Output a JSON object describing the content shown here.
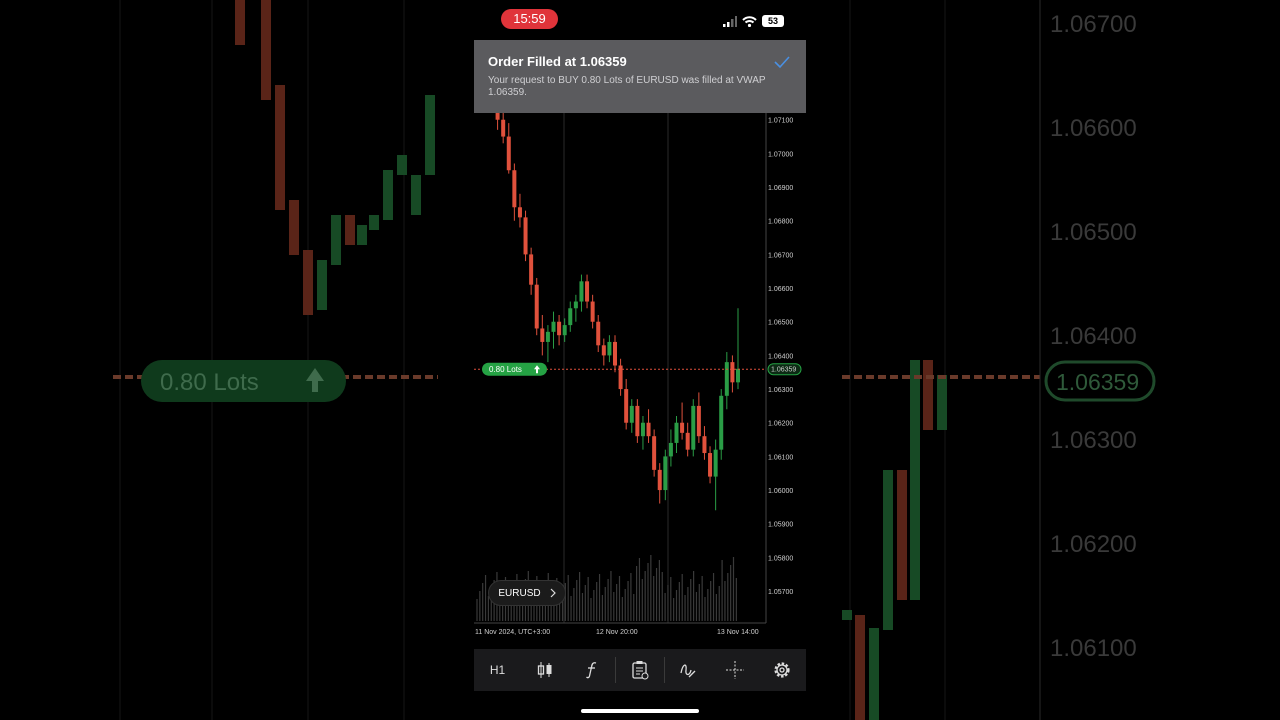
{
  "status_bar": {
    "time": "15:59",
    "battery": "53"
  },
  "toast": {
    "title": "Order Filled at 1.06359",
    "message": "Your request to BUY 0.80 Lots of EURUSD was filled at VWAP 1.06359."
  },
  "position": {
    "lots_label": "0.80 Lots",
    "price_label": "1.06359"
  },
  "symbol": "EURUSD",
  "toolbar": {
    "timeframe": "H1"
  },
  "background": {
    "lots_label": "0.80 Lots",
    "price_label": "1.06359",
    "price_ticks": [
      "1.06700",
      "1.06600",
      "1.06500",
      "1.06400",
      "1.06300",
      "1.06200",
      "1.06100"
    ]
  },
  "colors": {
    "bull": "#2a9d46",
    "bear": "#e0513c",
    "accent": "#4a90e2",
    "position": "#25a244"
  },
  "chart_data": {
    "type": "candlestick",
    "symbol": "EURUSD",
    "timeframe": "H1",
    "current_price": 1.06359,
    "position_price": 1.06359,
    "ylim": [
      1.0562,
      1.0712
    ],
    "y_ticks": [
      "1.07100",
      "1.07000",
      "1.06900",
      "1.06800",
      "1.06700",
      "1.06600",
      "1.06500",
      "1.06400",
      "1.06300",
      "1.06200",
      "1.06100",
      "1.06000",
      "1.05900",
      "1.05800",
      "1.05700"
    ],
    "x_labels": [
      "11 Nov 2024, UTC+3:00",
      "12 Nov 20:00",
      "13 Nov 14:00"
    ],
    "candles": [
      [
        1.0718,
        1.072,
        1.0712,
        1.0714
      ],
      [
        1.0714,
        1.0716,
        1.0707,
        1.071
      ],
      [
        1.071,
        1.0713,
        1.0703,
        1.0705
      ],
      [
        1.0705,
        1.0709,
        1.0694,
        1.0695
      ],
      [
        1.0695,
        1.0697,
        1.068,
        1.0684
      ],
      [
        1.0684,
        1.0688,
        1.0678,
        1.0681
      ],
      [
        1.0681,
        1.0683,
        1.0668,
        1.067
      ],
      [
        1.067,
        1.0672,
        1.0658,
        1.0661
      ],
      [
        1.0661,
        1.0663,
        1.0646,
        1.0648
      ],
      [
        1.0648,
        1.0652,
        1.064,
        1.0644
      ],
      [
        1.0644,
        1.0649,
        1.0638,
        1.0647
      ],
      [
        1.0647,
        1.0653,
        1.0642,
        1.065
      ],
      [
        1.065,
        1.0652,
        1.0643,
        1.0646
      ],
      [
        1.0646,
        1.0651,
        1.0644,
        1.0649
      ],
      [
        1.0649,
        1.0656,
        1.0647,
        1.0654
      ],
      [
        1.0654,
        1.0658,
        1.065,
        1.0656
      ],
      [
        1.0656,
        1.0664,
        1.0653,
        1.0662
      ],
      [
        1.0662,
        1.0664,
        1.0654,
        1.0656
      ],
      [
        1.0656,
        1.0658,
        1.0648,
        1.065
      ],
      [
        1.065,
        1.0652,
        1.0641,
        1.0643
      ],
      [
        1.0643,
        1.0645,
        1.0637,
        1.064
      ],
      [
        1.064,
        1.0646,
        1.0638,
        1.0644
      ],
      [
        1.0644,
        1.0646,
        1.0635,
        1.0637
      ],
      [
        1.0637,
        1.0639,
        1.0628,
        1.063
      ],
      [
        1.063,
        1.0633,
        1.0618,
        1.062
      ],
      [
        1.062,
        1.0627,
        1.0617,
        1.0625
      ],
      [
        1.0625,
        1.0627,
        1.0614,
        1.0616
      ],
      [
        1.0616,
        1.0622,
        1.0612,
        1.062
      ],
      [
        1.062,
        1.0624,
        1.0614,
        1.0616
      ],
      [
        1.0616,
        1.0618,
        1.0604,
        1.0606
      ],
      [
        1.0606,
        1.0608,
        1.0596,
        1.06
      ],
      [
        1.06,
        1.0612,
        1.0597,
        1.061
      ],
      [
        1.061,
        1.0618,
        1.0607,
        1.0614
      ],
      [
        1.0614,
        1.0622,
        1.0611,
        1.062
      ],
      [
        1.062,
        1.0626,
        1.0615,
        1.0617
      ],
      [
        1.0617,
        1.062,
        1.061,
        1.0612
      ],
      [
        1.0612,
        1.0627,
        1.061,
        1.0625
      ],
      [
        1.0625,
        1.0629,
        1.0614,
        1.0616
      ],
      [
        1.0616,
        1.0619,
        1.0609,
        1.0611
      ],
      [
        1.0611,
        1.0613,
        1.0602,
        1.0604
      ],
      [
        1.0604,
        1.0615,
        1.0594,
        1.0612
      ],
      [
        1.0612,
        1.063,
        1.0609,
        1.0628
      ],
      [
        1.0628,
        1.0641,
        1.0624,
        1.0638
      ],
      [
        1.0638,
        1.064,
        1.0629,
        1.0632
      ],
      [
        1.0632,
        1.0654,
        1.063,
        1.0636
      ]
    ]
  }
}
